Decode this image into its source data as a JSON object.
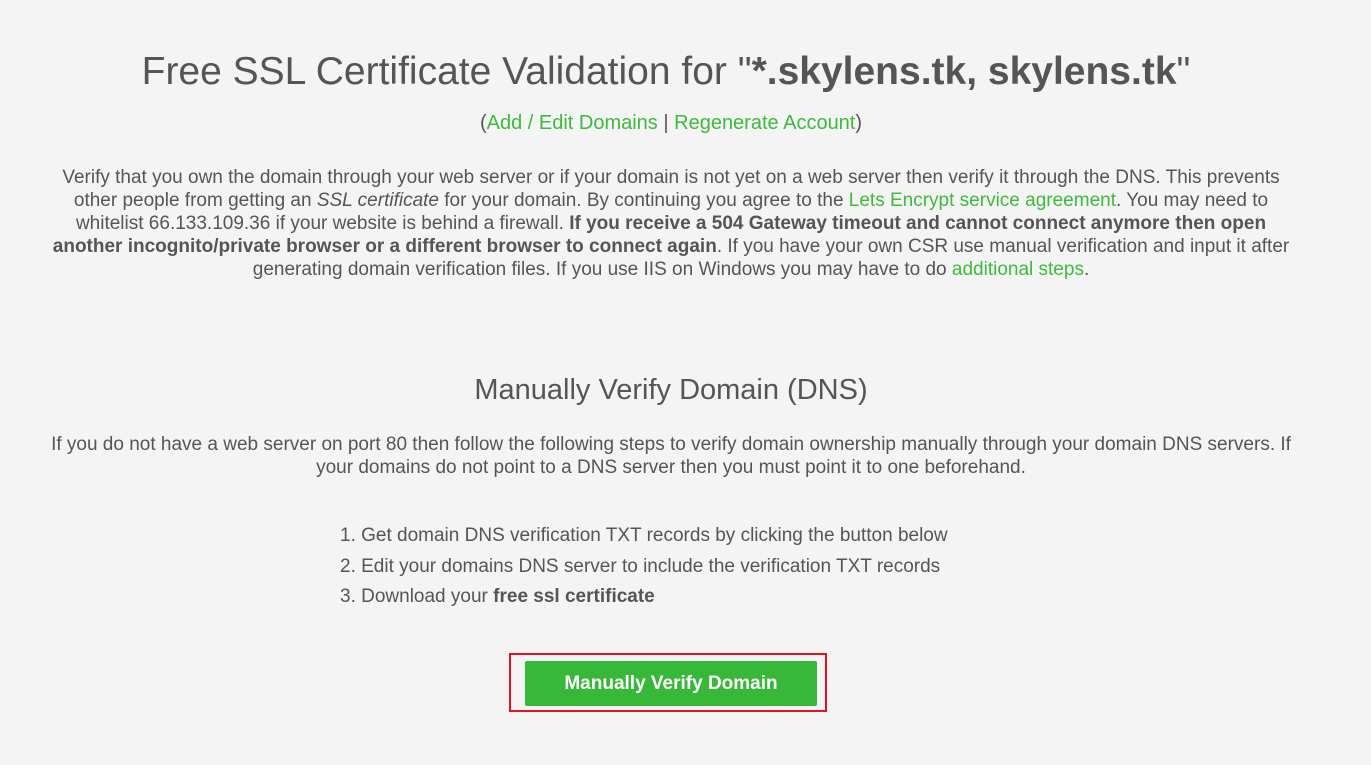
{
  "header": {
    "title_prefix": "Free SSL Certificate Validation for \"",
    "title_domains": "*.skylens.tk, skylens.tk",
    "title_suffix": "\""
  },
  "links": {
    "open_paren": "(",
    "add_edit_domains": "Add / Edit Domains",
    "separator": " | ",
    "regenerate_account": "Regenerate Account",
    "close_paren": ")"
  },
  "intro": {
    "part1": "Verify that you own the domain through your web server or if your domain is not yet on a web server then verify it through the DNS. This prevents other people from getting an ",
    "ssl_certificate": "SSL certificate",
    "part2": " for your domain. By continuing you agree to the ",
    "agreement_link": "Lets Encrypt service agreement",
    "part3": ". You may need to whitelist 66.133.109.36 if your website is behind a firewall. ",
    "bold_warning": "If you receive a 504 Gateway timeout and cannot connect anymore then open another incognito/private browser or a different browser to connect again",
    "part4": ". If you have your own CSR use manual verification and input it after generating domain verification files. If you use IIS on Windows you may have to do ",
    "additional_steps_link": "additional steps",
    "part5": "."
  },
  "dns_section": {
    "heading": "Manually Verify Domain (DNS)",
    "description": "If you do not have a web server on port 80 then follow the following steps to verify domain ownership manually through your domain DNS servers. If your domains do not point to a DNS server then you must point it to one beforehand.",
    "steps": {
      "step1": "1. Get domain DNS verification TXT records by clicking the button below",
      "step2": "2. Edit your domains DNS server to include the verification TXT records",
      "step3_prefix": "3. Download your ",
      "step3_bold": "free ssl certificate"
    },
    "verify_button_label": "Manually Verify Domain"
  },
  "colors": {
    "link": "#3dbb3d",
    "button": "#38b838",
    "highlight_border": "#e8121c",
    "text": "#555555",
    "background": "#f4f4f4"
  }
}
